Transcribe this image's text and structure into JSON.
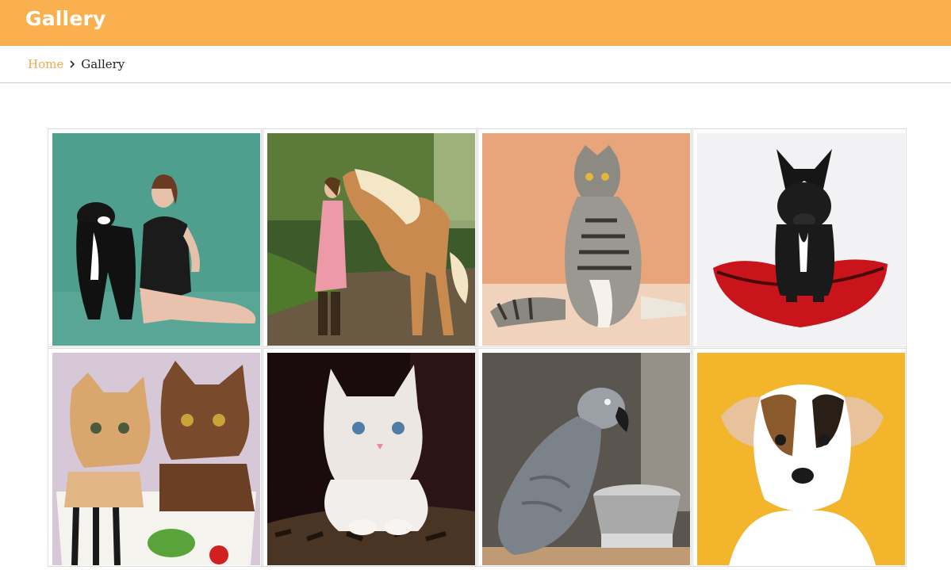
{
  "header": {
    "title": "Gallery",
    "bar_color": "#fbb04f"
  },
  "breadcrumb": {
    "home_label": "Home",
    "separator_icon": "chevron-right-icon",
    "current_label": "Gallery",
    "link_color": "#f2a84e"
  },
  "gallery": {
    "items": [
      {
        "name": "woman-with-dog-photo",
        "bg": "#4f9f8f"
      },
      {
        "name": "girl-with-horse-photo",
        "bg": "#3d5a2a"
      },
      {
        "name": "tabby-cat-sitting-photo",
        "bg": "#e8a47a"
      },
      {
        "name": "french-bulldog-on-red-cushion-photo",
        "bg": "#f2f2f4"
      },
      {
        "name": "two-kittens-in-cup-photo",
        "bg": "#d7c8d8"
      },
      {
        "name": "white-kitten-photo",
        "bg": "#1a0b0c"
      },
      {
        "name": "grey-parrot-photo",
        "bg": "#5b5550"
      },
      {
        "name": "jack-russell-puppy-photo",
        "bg": "#f2b52c"
      }
    ]
  }
}
